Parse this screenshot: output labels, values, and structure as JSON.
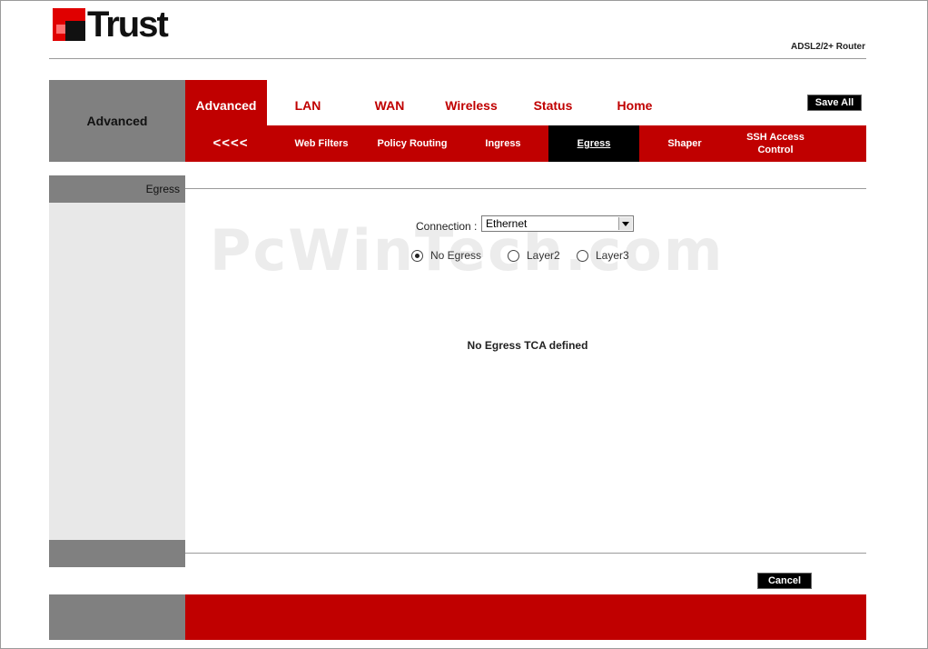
{
  "brand": {
    "logo_text": "Trust",
    "product": "ADSL2/2+ Router",
    "colors": {
      "red": "#c00000",
      "gray": "#808080",
      "light_gray": "#e8e8e8",
      "black": "#000000"
    }
  },
  "header": {
    "section_title": "Advanced",
    "tabs": [
      {
        "label": "Advanced",
        "active": true
      },
      {
        "label": "LAN"
      },
      {
        "label": "WAN"
      },
      {
        "label": "Wireless"
      },
      {
        "label": "Status"
      },
      {
        "label": "Home"
      }
    ],
    "save_all": "Save All",
    "subtabs": [
      {
        "label": "<<<<"
      },
      {
        "label": "Web Filters"
      },
      {
        "label": "Policy Routing"
      },
      {
        "label": "Ingress"
      },
      {
        "label": "Egress",
        "active": true
      },
      {
        "label": "Shaper"
      },
      {
        "label": "SSH Access Control"
      }
    ]
  },
  "sidebar": {
    "title": "Egress"
  },
  "watermark": "PcWinTech.com",
  "form": {
    "connection_label": "Connection :",
    "connection_value": "Ethernet",
    "radios": [
      {
        "label": "No Egress",
        "checked": true
      },
      {
        "label": "Layer2",
        "checked": false
      },
      {
        "label": "Layer3",
        "checked": false
      }
    ],
    "message": "No Egress TCA defined",
    "cancel": "Cancel"
  }
}
